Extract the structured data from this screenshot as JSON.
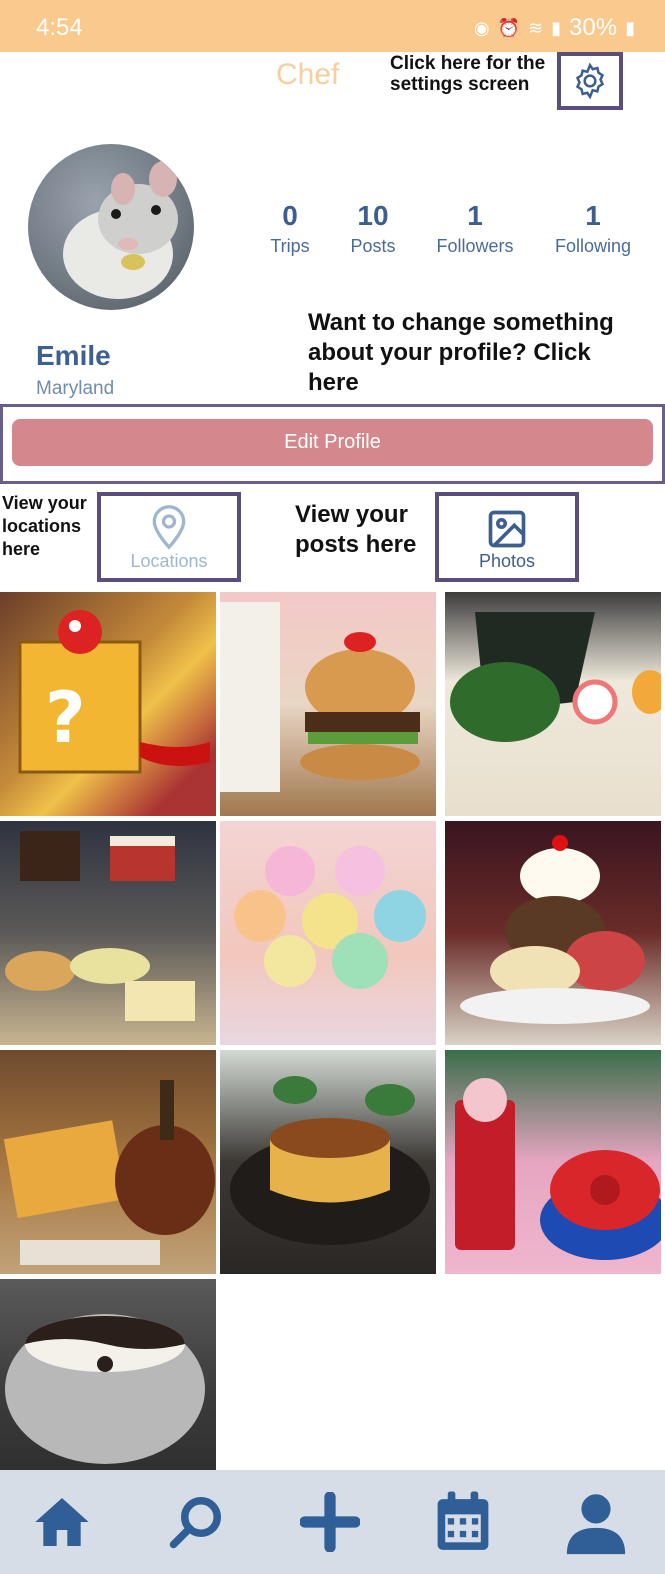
{
  "status_bar": {
    "time": "4:54",
    "battery": "30%"
  },
  "header": {
    "title": "Chef"
  },
  "annotations": {
    "settings": "Click here for the settings screen",
    "edit_profile": "Want to change something about your profile? Click here",
    "locations": "View your locations here",
    "photos": "View your posts here"
  },
  "profile": {
    "name": "Emile",
    "location": "Maryland",
    "stats": [
      {
        "value": "0",
        "label": "Trips"
      },
      {
        "value": "10",
        "label": "Posts"
      },
      {
        "value": "1",
        "label": "Followers"
      },
      {
        "value": "1",
        "label": "Following"
      }
    ]
  },
  "buttons": {
    "edit_profile": "Edit Profile"
  },
  "tabs": {
    "locations": "Locations",
    "photos": "Photos"
  },
  "photos": [
    "mario-block-cake",
    "mario-burger",
    "ramen",
    "cake-display-case",
    "pastel-swirl-cake",
    "ice-cream-sundae",
    "fries-and-burger",
    "flan",
    "mario-drink-and-dessert",
    "yin-yang-fondue"
  ],
  "bottom_nav": [
    "home-icon",
    "search-icon",
    "add-icon",
    "calendar-icon",
    "profile-icon"
  ],
  "colors": {
    "status_bar": "#f9c98d",
    "accent_blue": "#3d5f8f",
    "edit_button": "#d4888d",
    "annotation_border": "#5b4e7c",
    "nav_bg": "#d6dde6"
  }
}
